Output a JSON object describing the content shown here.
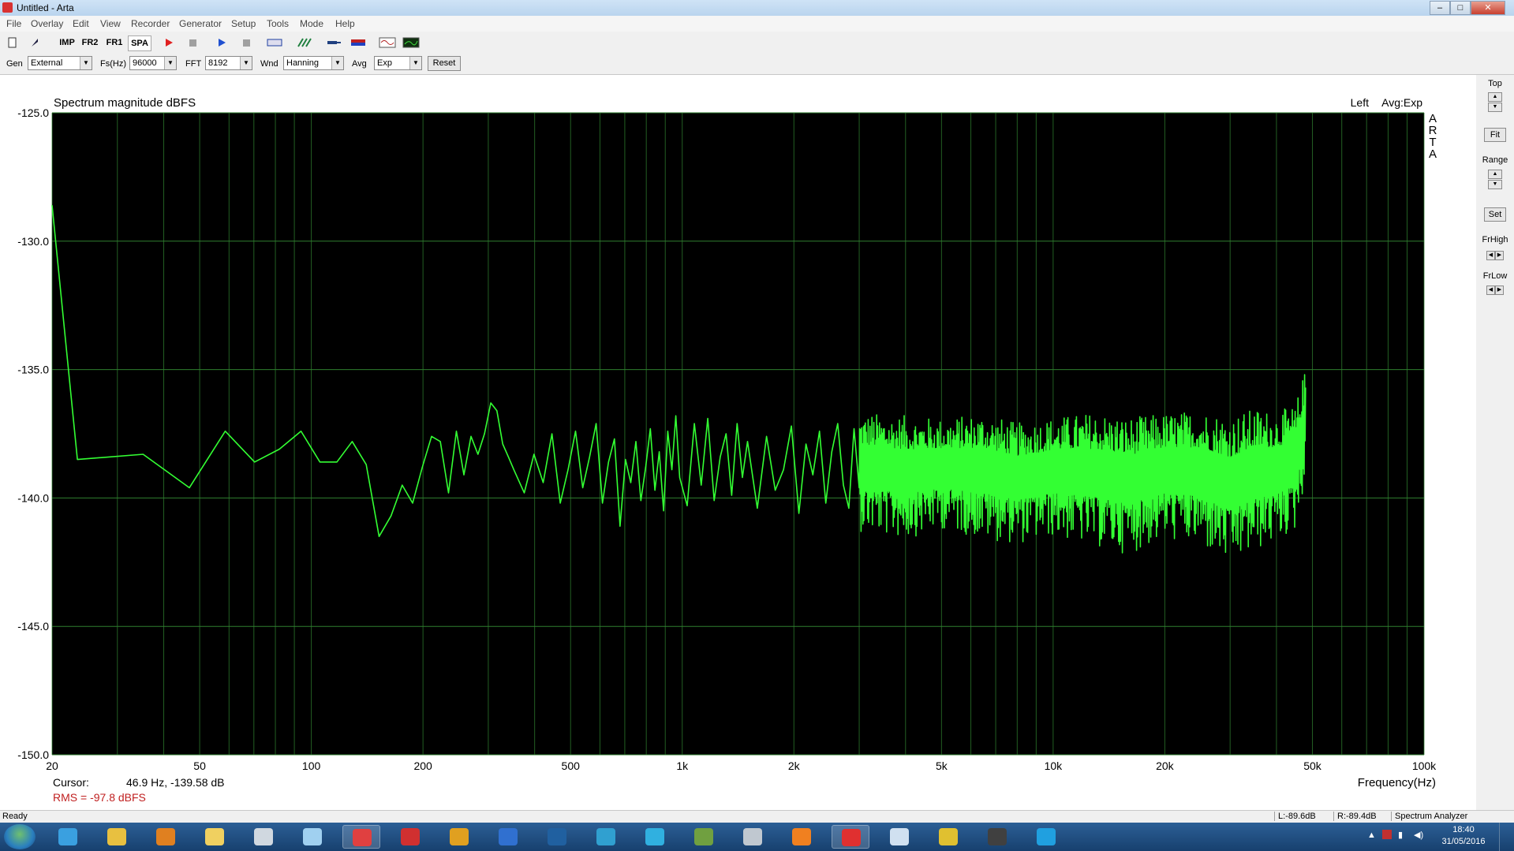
{
  "window": {
    "title": "Untitled - Arta",
    "minimize": "–",
    "maximize": "□",
    "close": "✕"
  },
  "menu": [
    "File",
    "Overlay",
    "Edit",
    "View",
    "Recorder",
    "Generator",
    "Setup",
    "Tools",
    "Mode",
    "Help"
  ],
  "toolbar": [
    {
      "icon": "new-icon",
      "label": "",
      "color": "#333"
    },
    {
      "icon": "open-icon",
      "label": "",
      "color": "#224"
    },
    {
      "icon": "imp-mode-icon",
      "label": "IMP",
      "color": "#000"
    },
    {
      "icon": "fr2-mode-icon",
      "label": "FR2",
      "color": "#000"
    },
    {
      "icon": "fr1-mode-icon",
      "label": "FR1",
      "color": "#000"
    },
    {
      "icon": "spa-mode-icon",
      "label": "SPA",
      "color": "#000"
    },
    {
      "icon": "record-icon",
      "label": "",
      "color": "#e02020"
    },
    {
      "icon": "stop-icon",
      "label": "",
      "color": "#a0a0a0"
    },
    {
      "icon": "play-icon",
      "label": "",
      "color": "#2050d0"
    },
    {
      "icon": "stop2-icon",
      "label": "",
      "color": "#a0a0a0"
    },
    {
      "icon": "rec-file-icon",
      "label": "",
      "color": "#2040a0"
    },
    {
      "icon": "grid-icon",
      "label": "",
      "color": "#208040"
    },
    {
      "icon": "probe-icon",
      "label": "",
      "color": "#204080"
    },
    {
      "icon": "flag-icon",
      "label": "",
      "color": "#c02020"
    },
    {
      "icon": "waveform-icon",
      "label": "",
      "color": "#b02020"
    },
    {
      "icon": "spectrum-icon",
      "label": "",
      "color": "#20a020"
    }
  ],
  "params": {
    "gen_label": "Gen",
    "gen_value": "External",
    "fs_label": "Fs(Hz)",
    "fs_value": "96000",
    "fft_label": "FFT",
    "fft_value": "8192",
    "wnd_label": "Wnd",
    "wnd_value": "Hanning",
    "avg_label": "Avg",
    "avg_value": "Exp",
    "reset_label": "Reset"
  },
  "chart_data": {
    "type": "line",
    "title": "Spectrum magnitude dBFS",
    "channel_label": "Left",
    "avg_label": "Avg:Exp",
    "brand_vertical": "ARTA",
    "xlabel": "Frequency(Hz)",
    "ylabel": "",
    "x_scale": "log",
    "xlim": [
      20,
      100000
    ],
    "ylim": [
      -150,
      -125
    ],
    "x_tick_values": [
      20,
      50,
      100,
      200,
      500,
      1000,
      2000,
      5000,
      10000,
      20000,
      50000,
      100000
    ],
    "x_tick_labels": [
      "20",
      "50",
      "100",
      "200",
      "500",
      "1k",
      "2k",
      "5k",
      "10k",
      "20k",
      "50k",
      "100k"
    ],
    "y_tick_values": [
      -125,
      -130,
      -135,
      -140,
      -145,
      -150
    ],
    "y_tick_labels": [
      "-125.0",
      "-130.0",
      "-135.0",
      "-140.0",
      "-145.0",
      "-150.0"
    ],
    "grid": true,
    "background": "#000000",
    "grid_color": "#2f7f2f",
    "trace_color": "#33ff33",
    "series": [
      {
        "x": [
          20,
          23.4,
          35.2,
          46.9,
          58.6,
          70.3,
          82,
          93.8,
          105.5,
          117.2,
          128.9,
          140.6,
          152.3,
          164,
          175.8,
          187.5,
          199.2,
          210.9,
          222.7,
          234.4,
          246.1,
          257.8,
          269.5,
          281.3,
          293,
          304.7,
          316.4,
          328.1,
          339.8,
          351.6,
          375,
          398.4,
          421.9,
          445.3,
          468.8,
          492.2,
          515.6,
          539.1,
          562.5,
          585.9,
          609.4,
          632.8,
          656.3,
          679.7,
          703.1,
          726.6,
          750,
          773.4,
          796.9,
          820.3,
          843.8,
          867.2,
          890.6,
          914.1,
          937.5,
          960.9,
          984.4,
          1031,
          1078,
          1125,
          1172,
          1219,
          1266,
          1313,
          1359,
          1406,
          1453,
          1500,
          1594,
          1688,
          1781,
          1875,
          1969,
          2063,
          2156,
          2250,
          2344,
          2438,
          2531,
          2625,
          2719,
          2813,
          2906,
          3000
        ],
        "y": [
          -128.6,
          -138.5,
          -138.3,
          -139.6,
          -137.4,
          -138.6,
          -138.1,
          -137.4,
          -138.6,
          -138.6,
          -137.8,
          -138.7,
          -141.5,
          -140.7,
          -139.5,
          -140.2,
          -138.8,
          -137.6,
          -137.8,
          -139.8,
          -137.4,
          -139.1,
          -137.6,
          -138.3,
          -137.5,
          -136.3,
          -136.6,
          -137.9,
          -138.4,
          -138.9,
          -139.8,
          -138.3,
          -139.4,
          -137.5,
          -140.2,
          -138.9,
          -137.4,
          -139.6,
          -138.4,
          -137.1,
          -140.2,
          -138.6,
          -137.7,
          -141.1,
          -138.5,
          -139.4,
          -137.8,
          -140.1,
          -138.8,
          -137.3,
          -139.7,
          -138.2,
          -140.5,
          -137.4,
          -138.9,
          -136.8,
          -139.2,
          -140.3,
          -137.1,
          -139.5,
          -136.9,
          -140.1,
          -138.4,
          -137.5,
          -139.9,
          -137.1,
          -139.2,
          -137.8,
          -140.4,
          -137.6,
          -139.7,
          -138.9,
          -137.2,
          -140.6,
          -137.9,
          -139.1,
          -137.4,
          -140.2,
          -138.2,
          -137.1,
          -139.5,
          -140.4,
          -137.3,
          -139.6
        ]
      }
    ],
    "noise_band": {
      "x": [
        3000,
        4000,
        5000,
        6500,
        8000,
        10000,
        13000,
        16000,
        20000,
        25000,
        30000,
        35000,
        40000,
        45000,
        48000
      ],
      "y_high": [
        -136.0,
        -136.1,
        -136.3,
        -136.0,
        -136.4,
        -136.2,
        -135.9,
        -136.1,
        -136.0,
        -135.8,
        -136.0,
        -135.7,
        -135.9,
        -135.7,
        -134.3
      ],
      "y_low": [
        -141.3,
        -141.6,
        -141.2,
        -141.6,
        -141.8,
        -141.5,
        -141.9,
        -142.2,
        -141.6,
        -141.9,
        -142.6,
        -142.1,
        -141.7,
        -141.3,
        -139.2
      ]
    },
    "cursor_label": "Cursor:",
    "cursor_readout": "46.9 Hz, -139.58 dB",
    "rms_readout": "RMS =  -97.8 dBFS"
  },
  "right_panel": {
    "top": "Top",
    "fit": "Fit",
    "range": "Range",
    "set": "Set",
    "frhigh": "FrHigh",
    "frlow": "FrLow"
  },
  "status": {
    "ready": "Ready",
    "left_level": "L:-89.6dB",
    "right_level": "R:-89.4dB",
    "mode": "Spectrum Analyzer"
  },
  "taskbar": {
    "apps": [
      {
        "icon": "internet-explorer-icon",
        "color": "#3aa0e0"
      },
      {
        "icon": "file-explorer-icon",
        "color": "#e8c040"
      },
      {
        "icon": "media-player-icon",
        "color": "#e08020"
      },
      {
        "icon": "folder-icon",
        "color": "#f0d060"
      },
      {
        "icon": "calculator-icon",
        "color": "#d0d8e0"
      },
      {
        "icon": "notes-icon",
        "color": "#a0d0f0"
      },
      {
        "icon": "snipping-tool-icon",
        "color": "#e04040"
      },
      {
        "icon": "pdf-reader-icon",
        "color": "#d03030"
      },
      {
        "icon": "vpn-icon",
        "color": "#e0a020"
      },
      {
        "icon": "google-earth-icon",
        "color": "#3070d0"
      },
      {
        "icon": "audio-app-icon",
        "color": "#2060a0"
      },
      {
        "icon": "search-app-icon",
        "color": "#30a0d0"
      },
      {
        "icon": "kodi-icon",
        "color": "#30b0e0"
      },
      {
        "icon": "spreadsheet-icon",
        "color": "#70a040"
      },
      {
        "icon": "document-icon",
        "color": "#c0c8d0"
      },
      {
        "icon": "vlc-icon",
        "color": "#f08020"
      },
      {
        "icon": "ccleaner-icon",
        "color": "#e03030"
      },
      {
        "icon": "messenger-icon",
        "color": "#d0e0f0"
      },
      {
        "icon": "chrome-icon",
        "color": "#e0c030"
      },
      {
        "icon": "id-app-icon",
        "color": "#404040"
      },
      {
        "icon": "skype-icon",
        "color": "#20a0e0"
      }
    ],
    "time": "18:40",
    "date": "31/05/2016"
  }
}
